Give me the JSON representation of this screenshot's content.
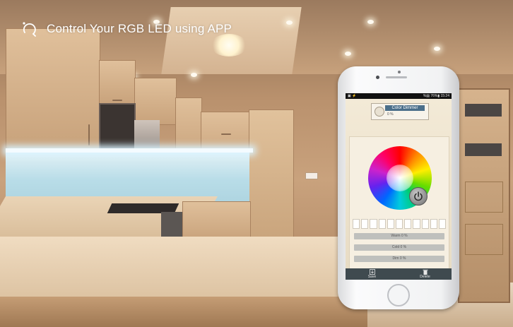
{
  "header": {
    "logo_icon": "circle-logo-icon",
    "title": "Control Your RGB LED using APP"
  },
  "phone": {
    "status_bar": {
      "left_icons": "▣ ⚡",
      "right_text": "%▤ 76%▮ 15:24"
    },
    "mode": {
      "title": "Color Dimmer",
      "value": "0 %",
      "icon": "bulb-icon"
    },
    "color_wheel": {
      "icon": "power-icon"
    },
    "swatch_count": 11,
    "sliders": [
      {
        "label": "Warm 0 %"
      },
      {
        "label": "Cold 0 %"
      },
      {
        "label": "Dim 0 %"
      }
    ],
    "bottom_bar": {
      "save_label": "Save",
      "save_icon": "download-icon",
      "delete_label": "Delete",
      "delete_icon": "trash-icon"
    }
  }
}
